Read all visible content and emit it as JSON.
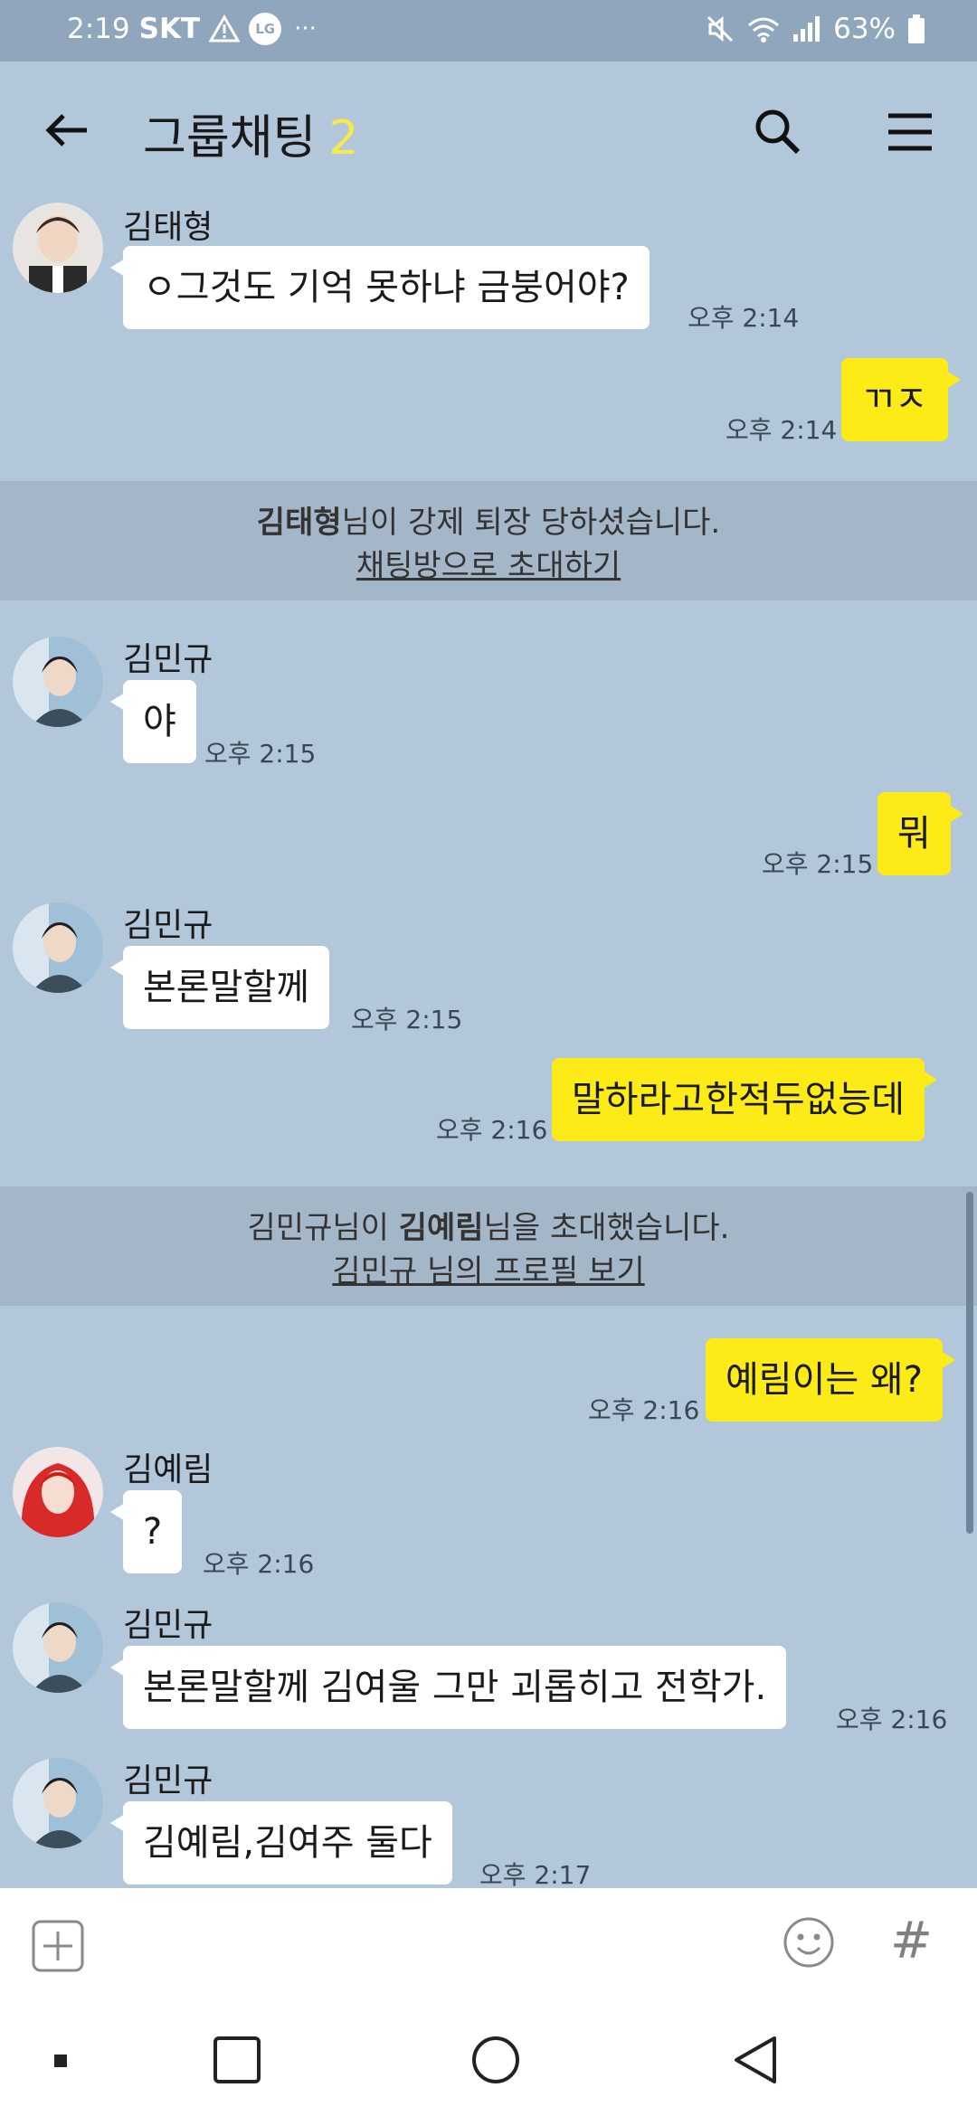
{
  "status_bar": {
    "time": "2:19",
    "carrier": "SKT",
    "lg_badge": "LG",
    "dots": "···",
    "battery": "63%",
    "icons": [
      "alert-icon",
      "mute-icon",
      "wifi-icon",
      "signal-icon",
      "battery-icon"
    ]
  },
  "header": {
    "title": "그룹채팅",
    "member_count": "2",
    "icons": [
      "back-arrow-icon",
      "search-icon",
      "menu-icon"
    ]
  },
  "messages": [
    {
      "sender": "김태형",
      "text": "ㅇ그것도 기억 못하냐 금붕어야?",
      "time": "오후 2:14"
    },
    {
      "text": "ㄲㅈ",
      "time": "오후 2:14"
    },
    {
      "sender": "김민규",
      "text": "야",
      "time": "오후 2:15"
    },
    {
      "text": "뭐",
      "time": "오후 2:15"
    },
    {
      "sender": "김민규",
      "text": "본론말할께",
      "time": "오후 2:15"
    },
    {
      "text": "말하라고한적두없능데",
      "time": "오후 2:16"
    },
    {
      "text": "예림이는 왜?",
      "time": "오후 2:16"
    },
    {
      "sender": "김예림",
      "text": "?",
      "time": "오후 2:16"
    },
    {
      "sender": "김민규",
      "text": "본론말할께 김여울 그만 괴롭히고 전학가.",
      "time": "오후 2:16"
    },
    {
      "sender": "김민규",
      "text": "김예림,김여주 둘다",
      "time": "오후 2:17"
    }
  ],
  "notices": [
    {
      "name": "김태형",
      "message": "님이 강제 퇴장 당하셨습니다.",
      "action": "채팅방으로 초대하기"
    },
    {
      "prefix": "김민규님이 ",
      "name": "김예림",
      "message": "님을 초대했습니다.",
      "action": "김민규 님의 프로필 보기"
    }
  ],
  "input_bar": {
    "hash": "#",
    "icons": [
      "add-icon",
      "emoji-icon",
      "hash-icon"
    ]
  },
  "nav_bar": {
    "icons": [
      "recent-apps-icon",
      "home-icon",
      "back-icon"
    ]
  },
  "colors": {
    "chat_background": "#b2c7da",
    "my_bubble": "#fdeb17",
    "other_bubble": "#ffffff",
    "notice_background": "#a4b7c9",
    "member_count": "#f6e94b"
  }
}
